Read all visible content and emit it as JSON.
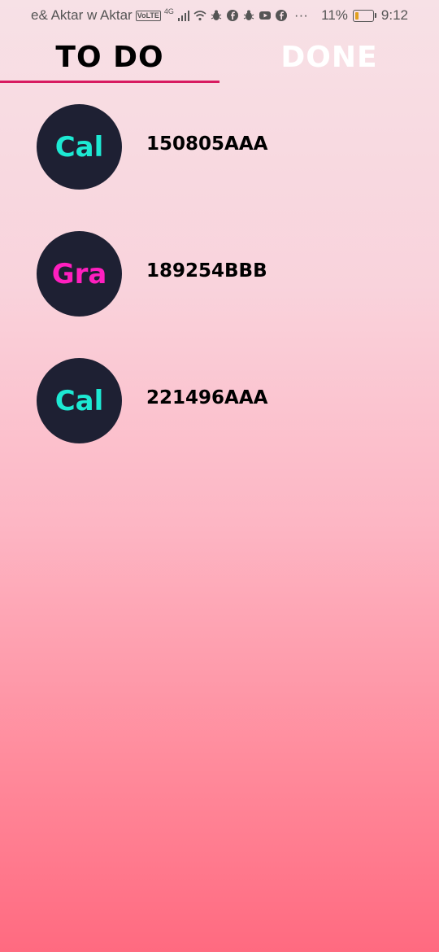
{
  "status_bar": {
    "carrier": "e& Aktar w Aktar",
    "volte": "VoLTE",
    "network": "4G",
    "battery_percent": "11%",
    "time": "9:12",
    "icons": [
      "wifi-icon",
      "bug-icon",
      "facebook-icon",
      "bug-icon",
      "youtube-icon",
      "facebook-icon",
      "more-icon"
    ],
    "more": "···"
  },
  "tabs": {
    "todo_label": "TO DO",
    "done_label": "DONE",
    "active": "todo",
    "indicator_color": "#d81b60"
  },
  "tasks": [
    {
      "avatar_text": "Cal",
      "avatar_color": "#1de9d3",
      "code": "150805AAA"
    },
    {
      "avatar_text": "Gra",
      "avatar_color": "#ff1fbf",
      "code": "189254BBB"
    },
    {
      "avatar_text": "Cal",
      "avatar_color": "#1de9d3",
      "code": "221496AAA"
    }
  ]
}
